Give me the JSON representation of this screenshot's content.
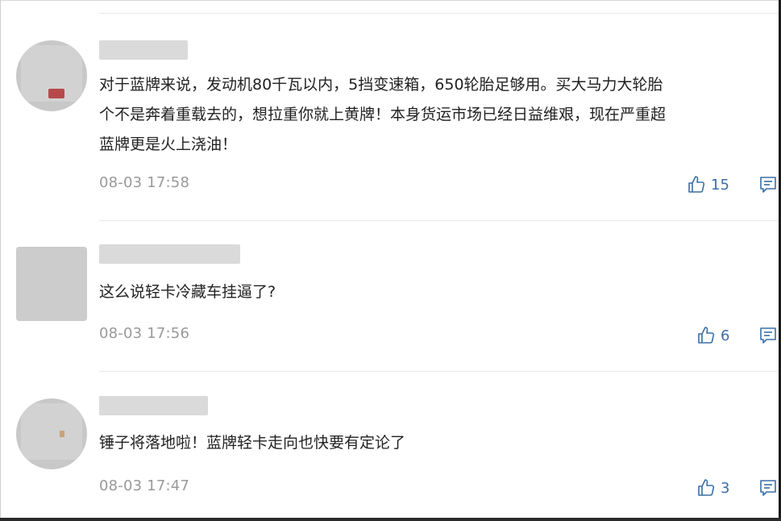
{
  "comments": [
    {
      "content_lines": [
        "对于蓝牌来说，发动机80千瓦以内，5挡变速箱，650轮胎足够用。买大马力大轮胎",
        "个不是奔着重载去的，想拉重你就上黄牌！本身货运市场已经日益维艰，现在严重超",
        "蓝牌更是火上浇油！"
      ],
      "time": "08-03 17:58",
      "likes": "15"
    },
    {
      "content_lines": [
        "这么说轻卡冷藏车挂逼了?"
      ],
      "time": "08-03 17:56",
      "likes": "6"
    },
    {
      "content_lines": [
        "锤子将落地啦！蓝牌轻卡走向也快要有定论了"
      ],
      "time": "08-03 17:47",
      "likes": "3"
    }
  ],
  "colors": {
    "accent": "#3a6ea5",
    "time": "#999999",
    "divider": "#e9e9e9",
    "text": "#222222"
  },
  "icons": {
    "like": "thumbs-up-icon",
    "reply": "comment-icon"
  }
}
